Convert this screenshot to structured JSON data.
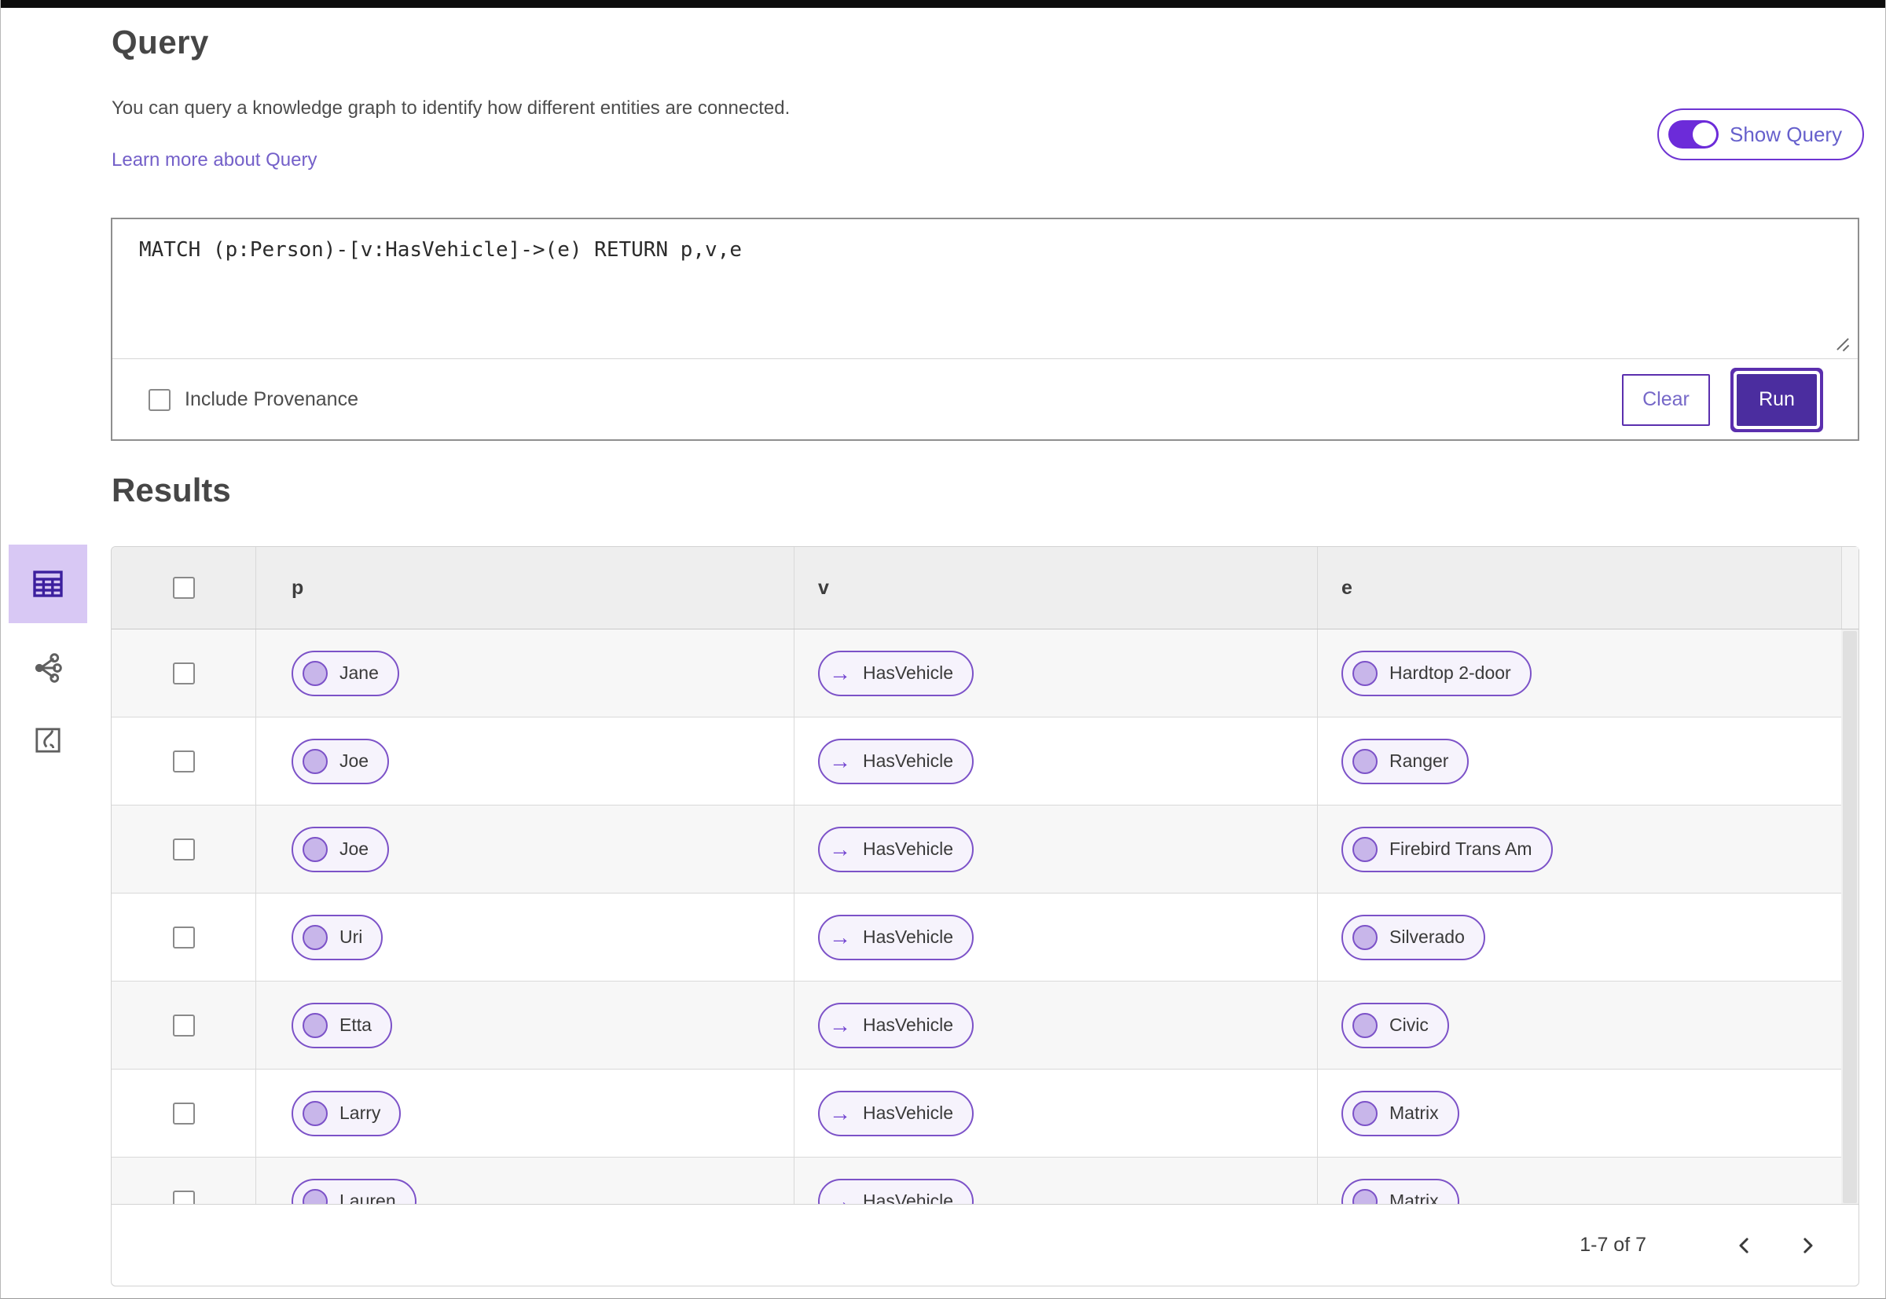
{
  "header": {
    "title": "Query",
    "description": "You can query a knowledge graph to identify how different entities are connected.",
    "learn_more_label": "Learn more about Query",
    "show_query_label": "Show Query",
    "show_query_on": true
  },
  "query_panel": {
    "query_text": "MATCH (p:Person)-[v:HasVehicle]->(e) RETURN p,v,e",
    "include_provenance_label": "Include Provenance",
    "include_provenance_checked": false,
    "clear_label": "Clear",
    "run_label": "Run"
  },
  "results": {
    "title": "Results",
    "view_switcher": [
      {
        "icon": "table-view-icon",
        "active": true
      },
      {
        "icon": "graph-view-icon",
        "active": false
      },
      {
        "icon": "map-view-icon",
        "active": false
      }
    ],
    "columns": [
      "p",
      "v",
      "e"
    ],
    "edge_arrow": "→",
    "rows": [
      {
        "p": "Jane",
        "v": "HasVehicle",
        "e": "Hardtop 2-door"
      },
      {
        "p": "Joe",
        "v": "HasVehicle",
        "e": "Ranger"
      },
      {
        "p": "Joe",
        "v": "HasVehicle",
        "e": "Firebird Trans Am"
      },
      {
        "p": "Uri",
        "v": "HasVehicle",
        "e": "Silverado"
      },
      {
        "p": "Etta",
        "v": "HasVehicle",
        "e": "Civic"
      },
      {
        "p": "Larry",
        "v": "HasVehicle",
        "e": "Matrix"
      },
      {
        "p": "Lauren",
        "v": "HasVehicle",
        "e": "Matrix"
      }
    ],
    "pagination": {
      "range_label": "1-7 of 7"
    }
  },
  "colors": {
    "accent_deep_purple": "#4b2d9f",
    "toggle_purple": "#6c2bd9",
    "chip_border": "#7c52c8",
    "chip_bg": "#f6f3fc",
    "chip_circle": "#c8b6ea",
    "link_purple": "#7460c9",
    "active_tile_bg": "#d8c8f4",
    "header_row_bg": "#eeeeee",
    "alt_row_bg": "#f7f7f7"
  }
}
